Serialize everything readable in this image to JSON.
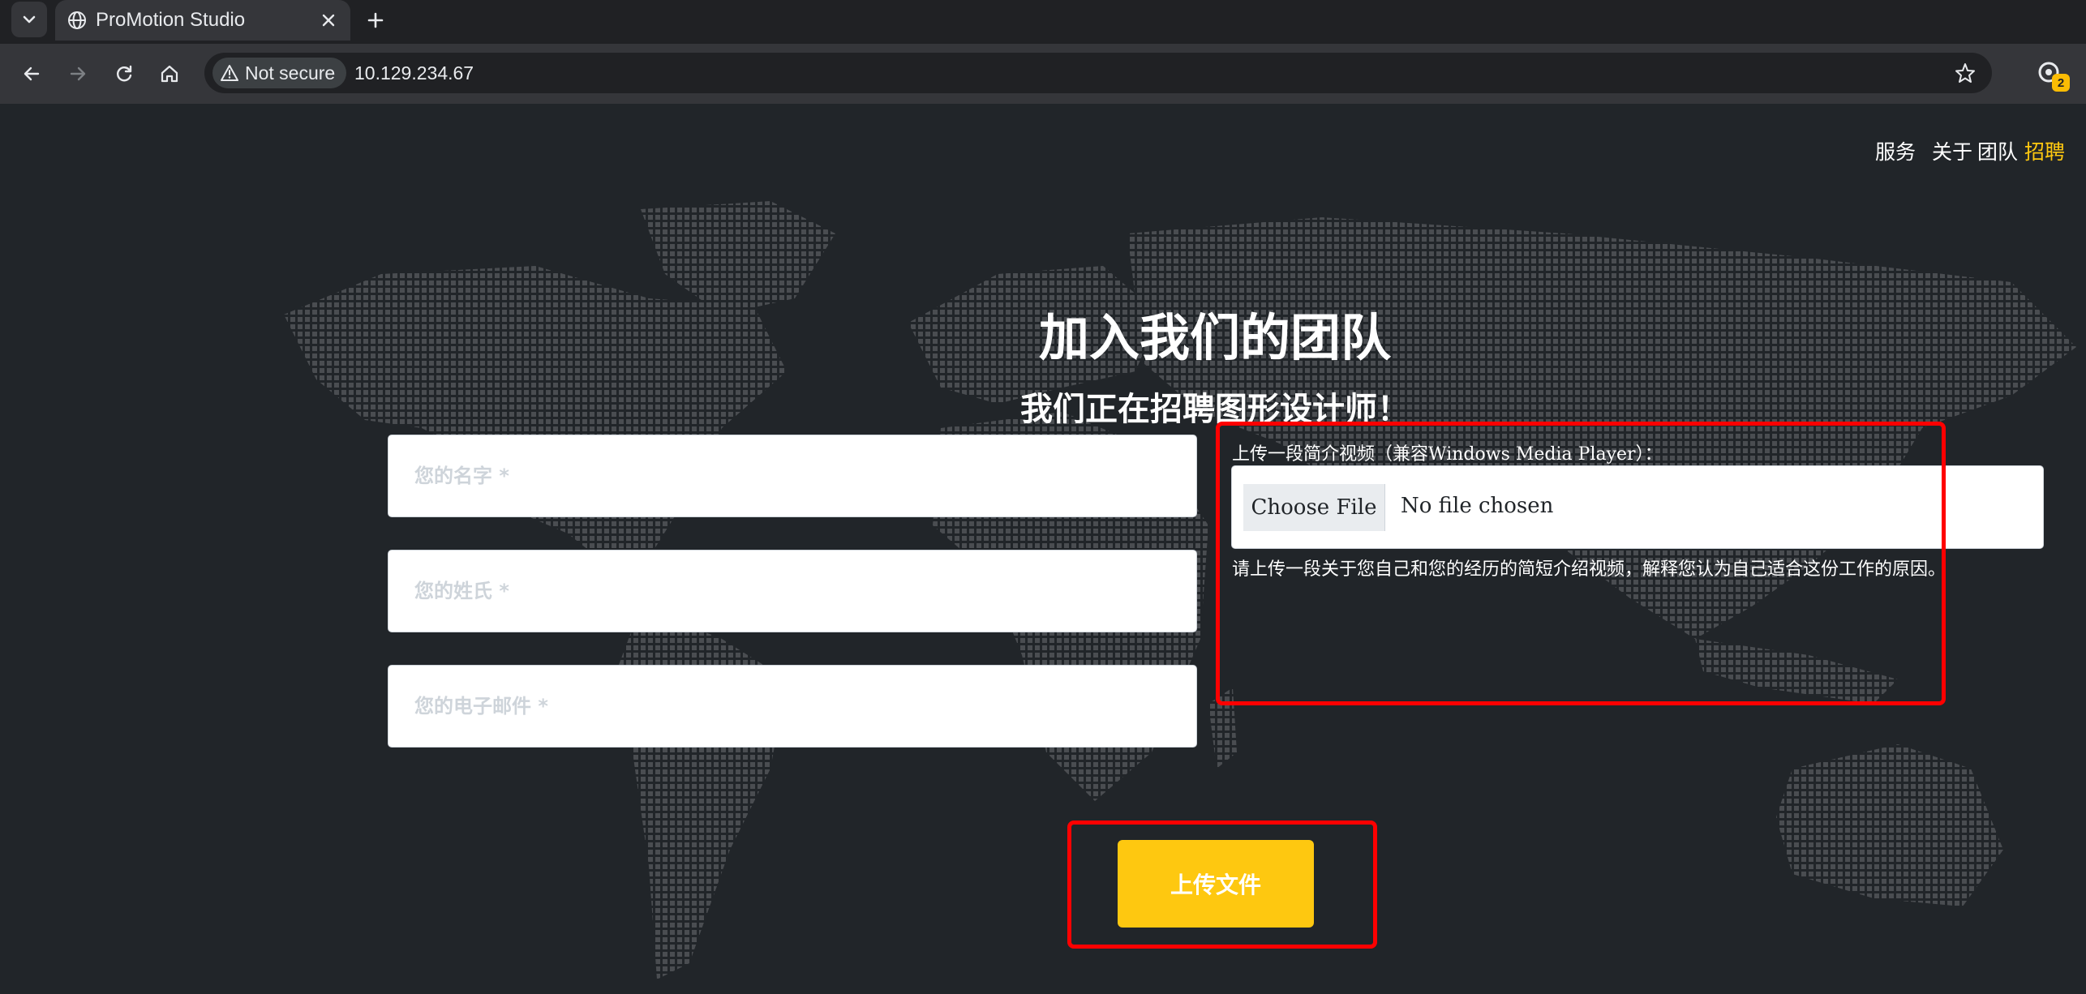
{
  "browser": {
    "tab_title": "ProMotion Studio",
    "security_chip": "Not secure",
    "url": "10.129.234.67",
    "extension_badge": "2"
  },
  "page": {
    "nav": [
      "服务",
      "关于",
      "团队",
      "招聘"
    ],
    "heading": "加入我们的团队",
    "subheading": "我们正在招聘图形设计师！",
    "fields": {
      "first_name_placeholder": "您的名字 *",
      "last_name_placeholder": "您的姓氏 *",
      "email_placeholder": "您的电子邮件 *"
    },
    "upload": {
      "label": "上传一段简介视频（兼容Windows Media Player）：",
      "choose_button": "Choose File",
      "status": "No file chosen",
      "help": "请上传一段关于您自己和您的经历的简短介绍视频，解释您认为自己适合这份工作的原因。"
    },
    "submit_label": "上传文件"
  },
  "colors": {
    "accent": "#fec810",
    "highlight": "#ff0000",
    "page_bg": "#212529"
  }
}
